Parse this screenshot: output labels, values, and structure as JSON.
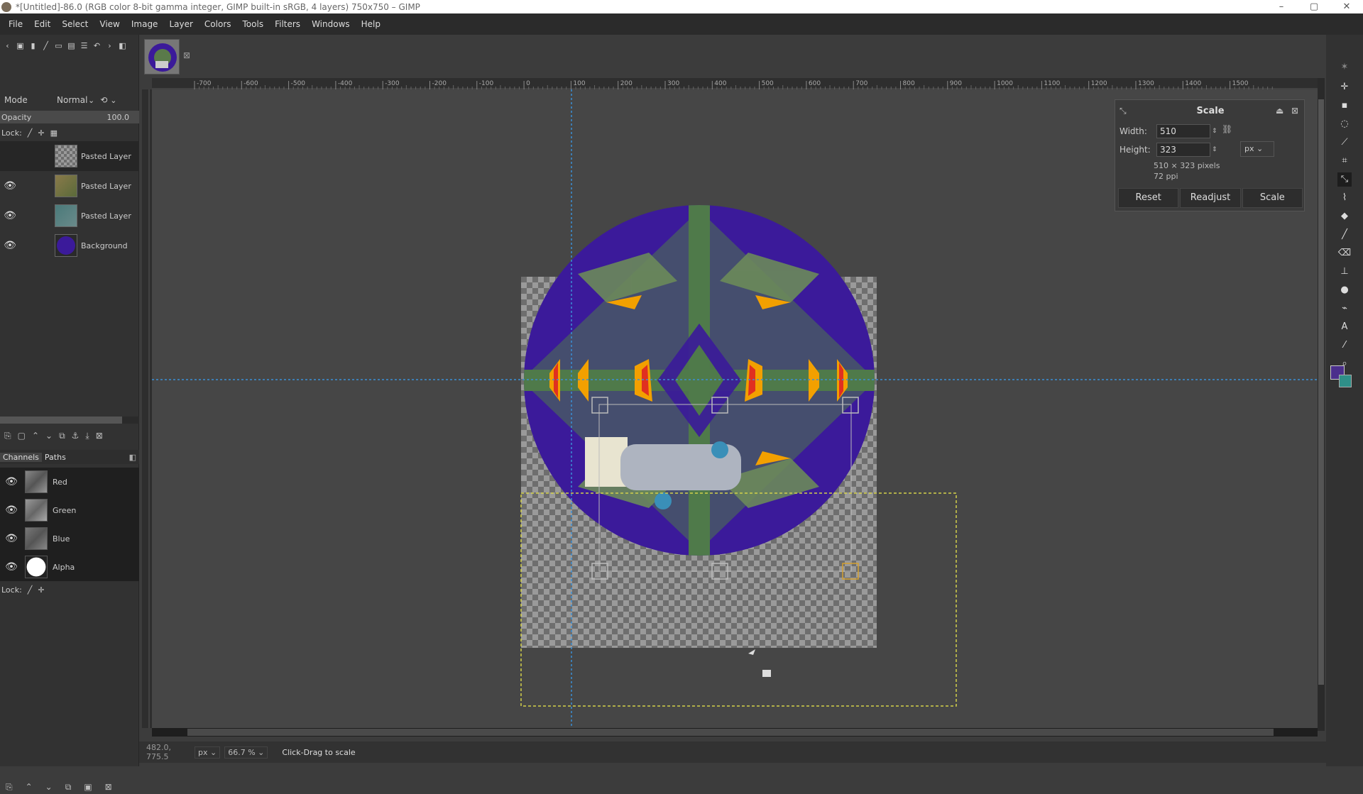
{
  "window": {
    "title": "*[Untitled]-86.0 (RGB color 8-bit gamma integer, GIMP built-in sRGB, 4 layers) 750x750 – GIMP",
    "minimize": "–",
    "maximize": "▢",
    "close": "✕"
  },
  "menu": [
    "File",
    "Edit",
    "Select",
    "View",
    "Image",
    "Layer",
    "Colors",
    "Tools",
    "Filters",
    "Windows",
    "Help"
  ],
  "layers_panel": {
    "mode_label": "Mode",
    "mode_value": "Normal",
    "opacity_label": "Opacity",
    "opacity_value": "100.0",
    "lock_label": "Lock:",
    "layers": [
      {
        "name": "Pasted Layer",
        "visible": false,
        "active": true
      },
      {
        "name": "Pasted Layer",
        "visible": true,
        "active": false
      },
      {
        "name": "Pasted Layer",
        "visible": true,
        "active": false
      },
      {
        "name": "Background",
        "visible": true,
        "active": false
      }
    ]
  },
  "channels_panel": {
    "tab_channels": "Channels",
    "tab_paths": "Paths",
    "channels": [
      {
        "name": "Red"
      },
      {
        "name": "Green"
      },
      {
        "name": "Blue"
      },
      {
        "name": "Alpha"
      }
    ],
    "lock_label": "Lock:"
  },
  "ruler_labels": [
    "-700",
    "-600",
    "-500",
    "-400",
    "-300",
    "-200",
    "-100",
    "0",
    "100",
    "200",
    "300",
    "400",
    "500",
    "600",
    "700",
    "800",
    "900",
    "1000",
    "1100",
    "1200",
    "1300",
    "1400",
    "1500"
  ],
  "scale_dialog": {
    "title": "Scale",
    "width_label": "Width:",
    "width_value": "510",
    "height_label": "Height:",
    "height_value": "323",
    "unit": "px",
    "size_info": "510 × 323 pixels",
    "resolution_info": "72 ppi",
    "reset_label": "Reset",
    "readjust_label": "Readjust",
    "scale_label": "Scale"
  },
  "statusbar": {
    "coords": "482.0, 775.5",
    "unit": "px",
    "zoom": "66.7 %",
    "message": "Click-Drag to scale"
  },
  "colors": {
    "foreground": "#4b2f8c",
    "background": "#2f8f88",
    "guide": "#3a8fd6",
    "selection": "#d4d14a"
  }
}
